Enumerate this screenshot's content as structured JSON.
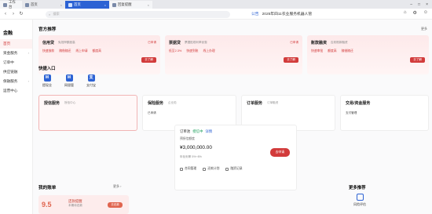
{
  "tabs": [
    {
      "label": "工作台",
      "state": "light"
    },
    {
      "label": "首页",
      "state": "normal"
    },
    {
      "label": "首页",
      "state": "active"
    },
    {
      "label": "回复提醒",
      "state": "light"
    }
  ],
  "nav": {
    "back": "‹",
    "forward": "›",
    "refresh": "↻"
  },
  "search": {
    "placeholder": "搜索"
  },
  "notice": {
    "tag": "公告",
    "text": "2025年四11农业服务机器人管"
  },
  "sidebar": {
    "logo": "金融",
    "items": [
      {
        "label": "首页",
        "active": true,
        "arrow": ""
      },
      {
        "label": "资金服务",
        "active": false,
        "arrow": "›"
      },
      {
        "label": "订单中",
        "active": false,
        "arrow": ""
      },
      {
        "label": "供应链融",
        "active": false,
        "arrow": ""
      },
      {
        "label": "保融服务",
        "active": false,
        "arrow": "›"
      },
      {
        "label": "运营中心",
        "active": false,
        "arrow": ""
      }
    ]
  },
  "official": {
    "title": "官方推荐",
    "more": "更多"
  },
  "recs": [
    {
      "title": "信用贷",
      "sub": "免抵押额度高",
      "badge": "已申请",
      "tags": [
        "快速放款",
        "随借随还",
        "线上申请",
        "额度高"
      ],
      "btn": "去了解"
    },
    {
      "title": "票据贷",
      "sub": "票据贴现利率优惠",
      "badge": "已申请",
      "tags": [
        "低至2.3%",
        "快速到账",
        "线上办理"
      ],
      "btn": "去了解"
    },
    {
      "title": "账款融资",
      "sub": "应收账款融资",
      "badge": "",
      "tags": [
        "快速审批",
        "额度高",
        "随借随还"
      ],
      "btn": "去了解"
    }
  ],
  "quick": {
    "title": "快捷入口",
    "items": [
      {
        "label": "提现业",
        "icon": "M"
      },
      {
        "label": "网银管",
        "icon": "M"
      },
      {
        "label": "支付宝",
        "icon": "支"
      }
    ]
  },
  "services": [
    {
      "title": "授信服务",
      "sub": "授信中心",
      "line": "",
      "active": true
    },
    {
      "title": "保险服务",
      "sub": "企业险",
      "line": "已申请",
      "active": false
    },
    {
      "title": "订单服务",
      "sub": "订单融资",
      "line": "",
      "active": false
    },
    {
      "title": "交易/资金服务",
      "sub": "",
      "line": "支付管理",
      "active": false
    }
  ],
  "center": {
    "head": "订单池",
    "status": "授信中",
    "link": "详情",
    "label": "预授信额度",
    "amount": "¥3,000,000.00",
    "rate": "年化利率 5%~8%",
    "button": "去申请",
    "foot": [
      "合同管理",
      "还款计划",
      "融资记录"
    ]
  },
  "calendar": {
    "title": "我的账单",
    "more": "更多 ›",
    "big": "9.5",
    "ct": "还款提醒",
    "cs": "本期待还款",
    "btn": "去还款"
  },
  "more_recs": {
    "title": "更多推荐",
    "item": "风险评估"
  }
}
